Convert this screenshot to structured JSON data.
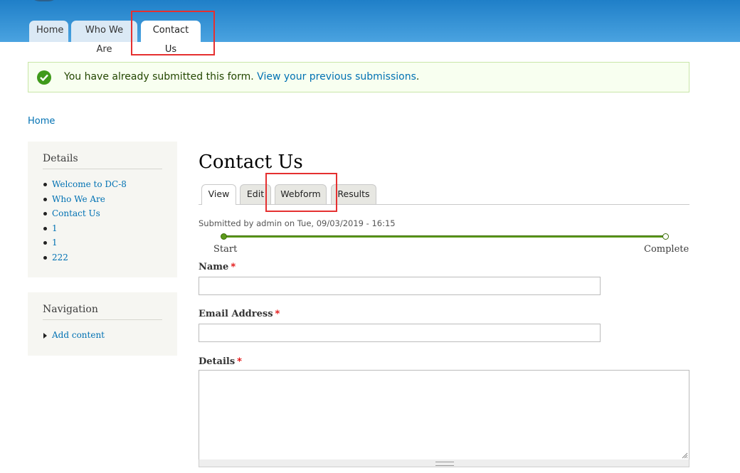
{
  "header": {
    "tabs": [
      {
        "label": "Home"
      },
      {
        "label": "Who We Are"
      },
      {
        "label": "Contact Us"
      }
    ]
  },
  "message": {
    "text": "You have already submitted this form.",
    "link": "View your previous submissions",
    "suffix": "."
  },
  "breadcrumb": {
    "home": "Home"
  },
  "sidebar": {
    "details": {
      "title": "Details",
      "items": [
        "Welcome to DC-8",
        "Who We Are",
        "Contact Us",
        "1",
        "1",
        "222"
      ]
    },
    "navigation": {
      "title": "Navigation",
      "items": [
        "Add content"
      ]
    }
  },
  "main": {
    "title": "Contact Us",
    "tabs": [
      "View",
      "Edit",
      "Webform",
      "Results"
    ],
    "submitted": "Submitted by admin on Tue, 09/03/2019 - 16:15",
    "progress": {
      "start": "Start",
      "end": "Complete"
    },
    "fields": {
      "name": "Name",
      "email": "Email Address",
      "details": "Details",
      "required_mark": "*"
    }
  },
  "colors": {
    "header_blue": "#1f7fc8",
    "link": "#0071b3",
    "highlight": "#e53030",
    "success": "#3f9a1a"
  }
}
